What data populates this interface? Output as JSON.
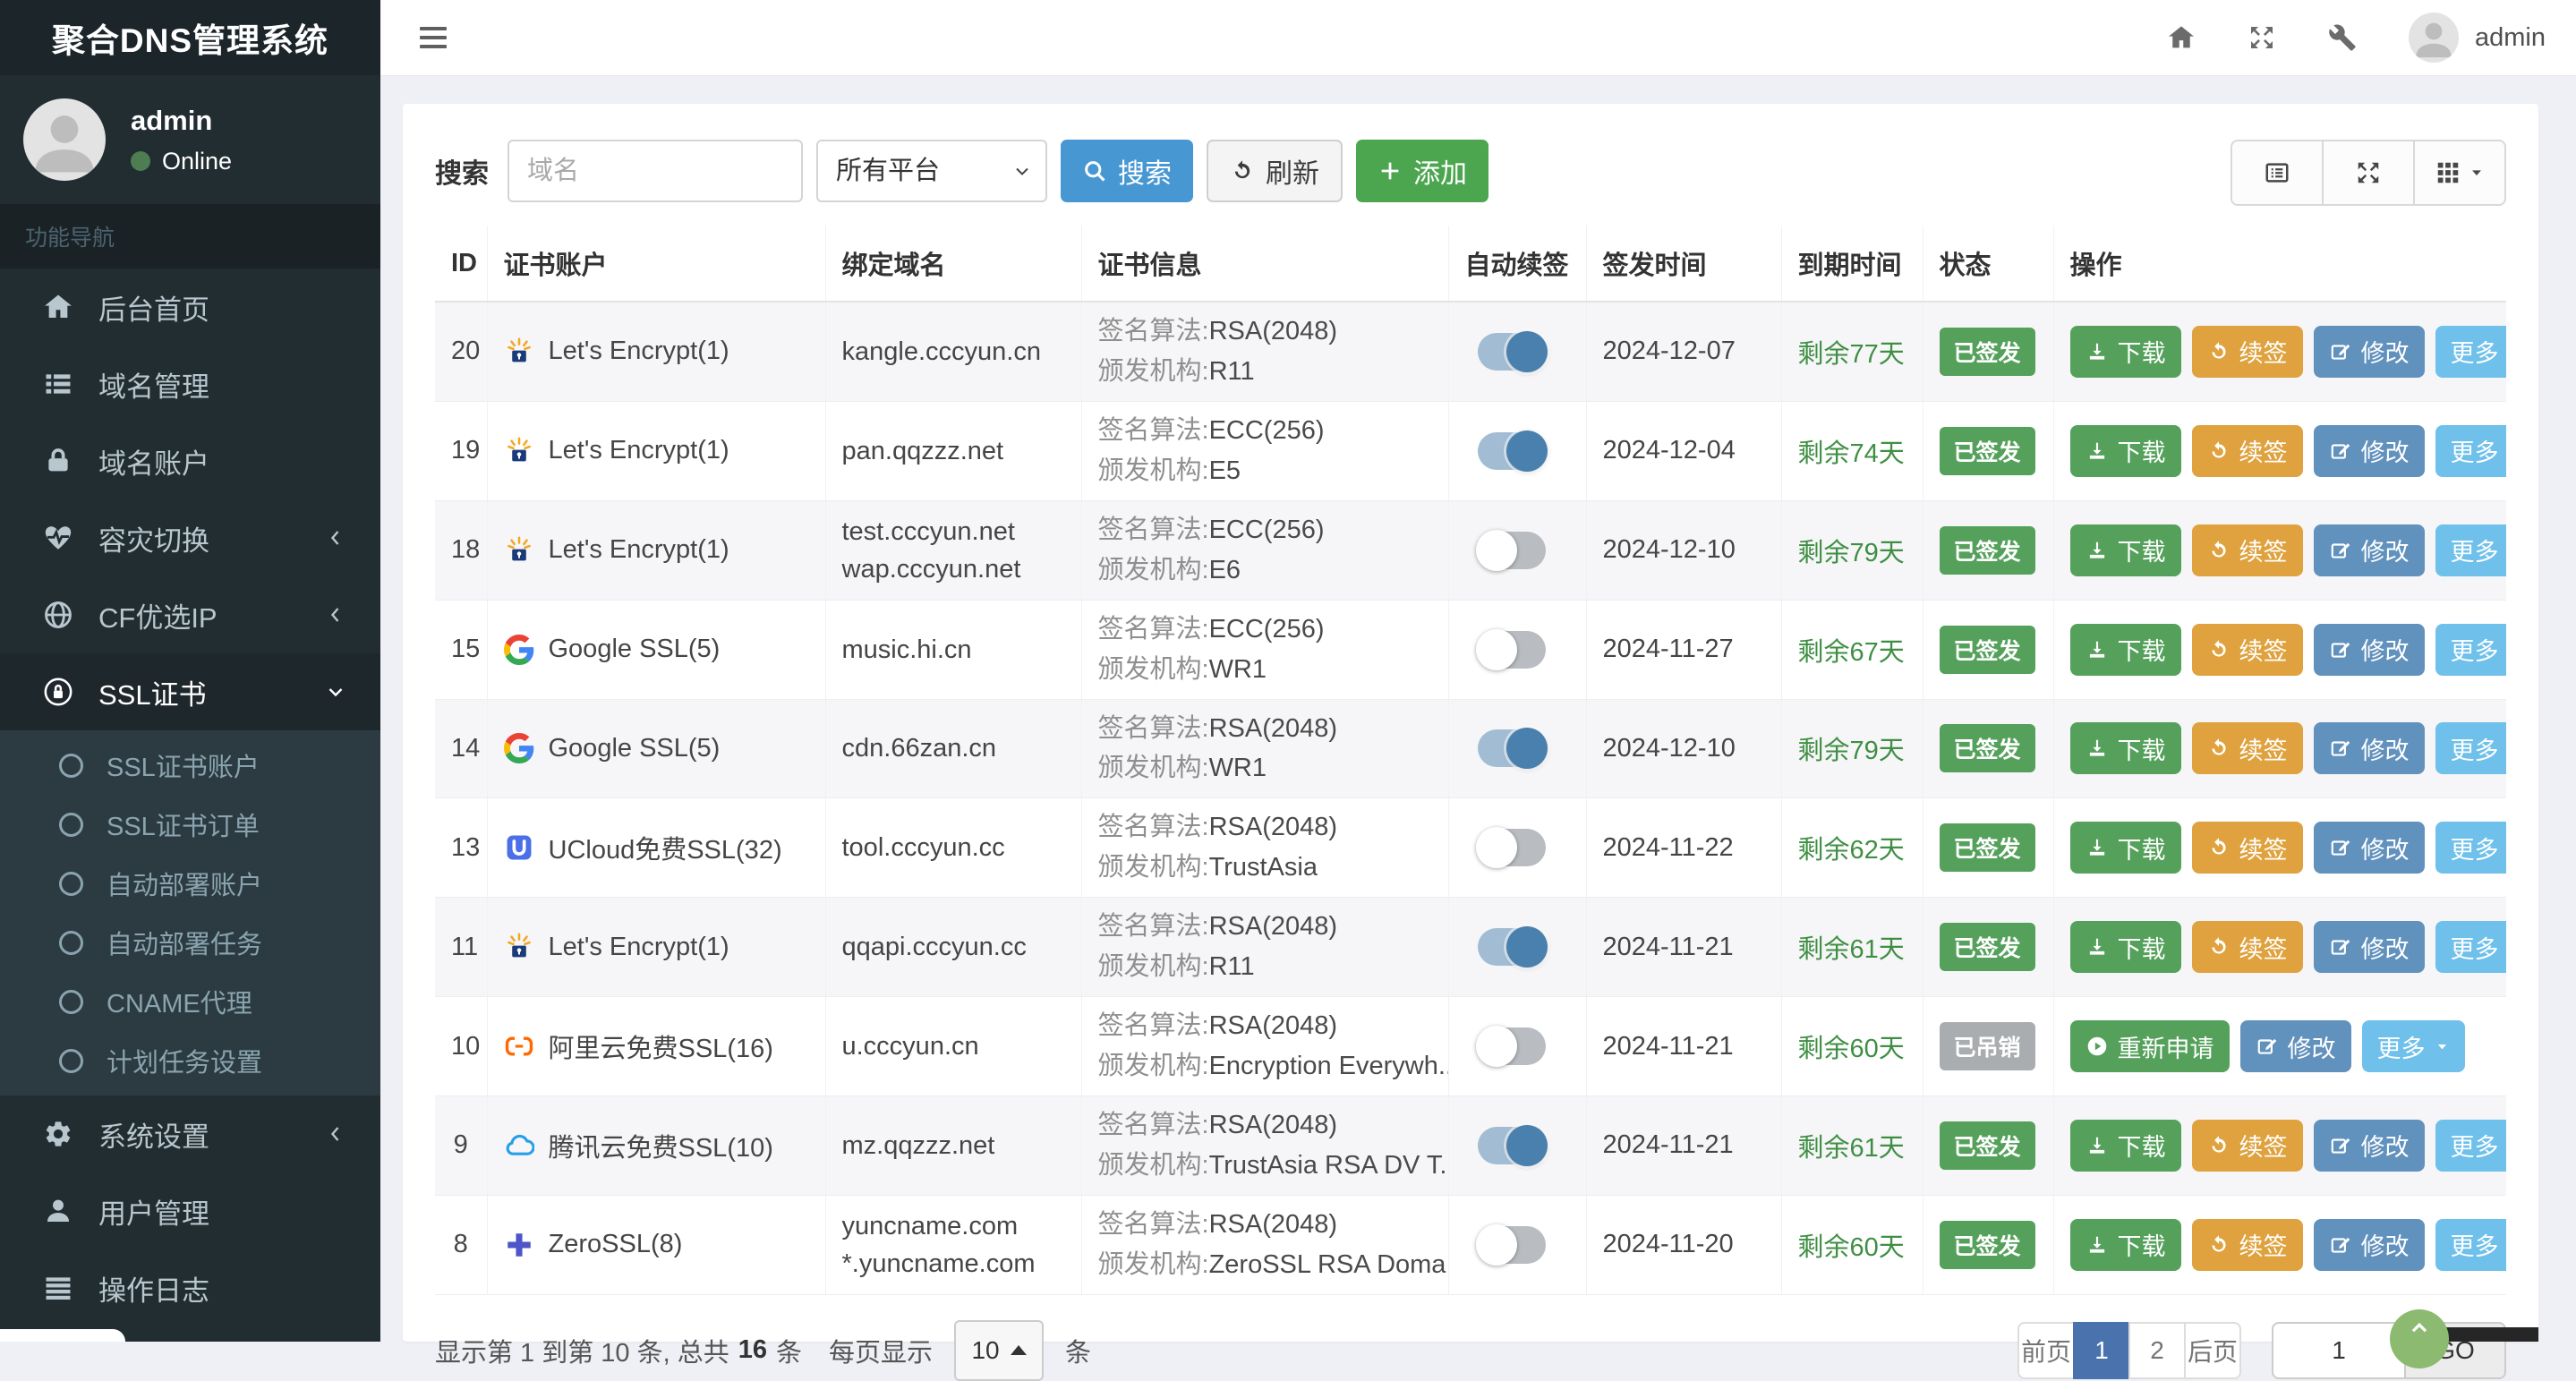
{
  "brand": {
    "title": "聚合DNS管理系统"
  },
  "user_panel": {
    "name": "admin",
    "status": "Online"
  },
  "sidebar": {
    "section_label": "功能导航",
    "items": [
      {
        "key": "home",
        "icon": "home-icon",
        "label": "后台首页"
      },
      {
        "key": "domain-manage",
        "icon": "list-icon",
        "label": "域名管理"
      },
      {
        "key": "domain-accounts",
        "icon": "lock-icon",
        "label": "域名账户"
      },
      {
        "key": "failover",
        "icon": "heartbeat-icon",
        "label": "容灾切换",
        "chevron": "left"
      },
      {
        "key": "cf-ip",
        "icon": "globe-icon",
        "label": "CF优选IP",
        "chevron": "left"
      },
      {
        "key": "ssl",
        "icon": "ssl-icon",
        "label": "SSL证书",
        "chevron": "down",
        "active": true,
        "children": [
          "SSL证书账户",
          "SSL证书订单",
          "自动部署账户",
          "自动部署任务",
          "CNAME代理",
          "计划任务设置"
        ]
      },
      {
        "key": "settings",
        "icon": "gears-icon",
        "label": "系统设置",
        "chevron": "left"
      },
      {
        "key": "users",
        "icon": "user-icon",
        "label": "用户管理"
      },
      {
        "key": "logs",
        "icon": "log-icon",
        "label": "操作日志"
      }
    ]
  },
  "topbar": {
    "user": "admin",
    "icons": [
      "home-icon",
      "arrows-expand-icon",
      "wrench-icon"
    ]
  },
  "toolbar": {
    "search_label": "搜索",
    "search_placeholder": "域名",
    "platform_select": "所有平台",
    "search_btn": "搜索",
    "refresh_btn": "刷新",
    "add_btn": "添加",
    "view_buttons": [
      {
        "icon": "list-alt-icon"
      },
      {
        "icon": "arrows-expand-icon"
      },
      {
        "icon": "grid-icon",
        "caret": true
      }
    ]
  },
  "table": {
    "columns": [
      "ID",
      "证书账户",
      "绑定域名",
      "证书信息",
      "自动续签",
      "签发时间",
      "到期时间",
      "状态",
      "操作"
    ],
    "info_labels": {
      "algo": "签名算法:",
      "issuer": "颁发机构:"
    },
    "rows": [
      {
        "id": "20",
        "provider_icon": "letsencrypt-icon",
        "account": "Let's Encrypt(1)",
        "domains": [
          "kangle.cccyun.cn"
        ],
        "algorithm": "RSA(2048)",
        "issuer": "R11",
        "auto_renew": true,
        "issued": "2024-12-07",
        "remaining": "剩余77天",
        "status": "已签发",
        "status_type": "success",
        "actions": [
          "download",
          "renew",
          "edit",
          "more"
        ]
      },
      {
        "id": "19",
        "provider_icon": "letsencrypt-icon",
        "account": "Let's Encrypt(1)",
        "domains": [
          "pan.qqzzz.net"
        ],
        "algorithm": "ECC(256)",
        "issuer": "E5",
        "auto_renew": true,
        "issued": "2024-12-04",
        "remaining": "剩余74天",
        "status": "已签发",
        "status_type": "success",
        "actions": [
          "download",
          "renew",
          "edit",
          "more"
        ]
      },
      {
        "id": "18",
        "provider_icon": "letsencrypt-icon",
        "account": "Let's Encrypt(1)",
        "domains": [
          "test.cccyun.net",
          "wap.cccyun.net"
        ],
        "algorithm": "ECC(256)",
        "issuer": "E6",
        "auto_renew": false,
        "issued": "2024-12-10",
        "remaining": "剩余79天",
        "status": "已签发",
        "status_type": "success",
        "actions": [
          "download",
          "renew",
          "edit",
          "more"
        ]
      },
      {
        "id": "15",
        "provider_icon": "google-icon",
        "account": "Google SSL(5)",
        "domains": [
          "music.hi.cn"
        ],
        "algorithm": "ECC(256)",
        "issuer": "WR1",
        "auto_renew": false,
        "issued": "2024-11-27",
        "remaining": "剩余67天",
        "status": "已签发",
        "status_type": "success",
        "actions": [
          "download",
          "renew",
          "edit",
          "more"
        ]
      },
      {
        "id": "14",
        "provider_icon": "google-icon",
        "account": "Google SSL(5)",
        "domains": [
          "cdn.66zan.cn"
        ],
        "algorithm": "RSA(2048)",
        "issuer": "WR1",
        "auto_renew": true,
        "issued": "2024-12-10",
        "remaining": "剩余79天",
        "status": "已签发",
        "status_type": "success",
        "actions": [
          "download",
          "renew",
          "edit",
          "more"
        ]
      },
      {
        "id": "13",
        "provider_icon": "ucloud-icon",
        "account": "UCloud免费SSL(32)",
        "domains": [
          "tool.cccyun.cc"
        ],
        "algorithm": "RSA(2048)",
        "issuer": "TrustAsia",
        "auto_renew": false,
        "issued": "2024-11-22",
        "remaining": "剩余62天",
        "status": "已签发",
        "status_type": "success",
        "actions": [
          "download",
          "renew",
          "edit",
          "more"
        ]
      },
      {
        "id": "11",
        "provider_icon": "letsencrypt-icon",
        "account": "Let's Encrypt(1)",
        "domains": [
          "qqapi.cccyun.cc"
        ],
        "algorithm": "RSA(2048)",
        "issuer": "R11",
        "auto_renew": true,
        "issued": "2024-11-21",
        "remaining": "剩余61天",
        "status": "已签发",
        "status_type": "success",
        "actions": [
          "download",
          "renew",
          "edit",
          "more"
        ]
      },
      {
        "id": "10",
        "provider_icon": "aliyun-icon",
        "account": "阿里云免费SSL(16)",
        "domains": [
          "u.cccyun.cn"
        ],
        "algorithm": "RSA(2048)",
        "issuer": "Encryption Everywh...",
        "auto_renew": false,
        "issued": "2024-11-21",
        "remaining": "剩余60天",
        "status": "已吊销",
        "status_type": "revoked",
        "actions": [
          "reapply",
          "edit",
          "more"
        ]
      },
      {
        "id": "9",
        "provider_icon": "tencentcloud-icon",
        "account": "腾讯云免费SSL(10)",
        "domains": [
          "mz.qqzzz.net"
        ],
        "algorithm": "RSA(2048)",
        "issuer": "TrustAsia RSA DV T...",
        "auto_renew": true,
        "issued": "2024-11-21",
        "remaining": "剩余61天",
        "status": "已签发",
        "status_type": "success",
        "actions": [
          "download",
          "renew",
          "edit",
          "more"
        ]
      },
      {
        "id": "8",
        "provider_icon": "zerossl-icon",
        "account": "ZeroSSL(8)",
        "domains": [
          "yuncname.com",
          "*.yuncname.com"
        ],
        "algorithm": "RSA(2048)",
        "issuer": "ZeroSSL RSA Doma...",
        "auto_renew": false,
        "issued": "2024-11-20",
        "remaining": "剩余60天",
        "status": "已签发",
        "status_type": "success",
        "actions": [
          "download",
          "renew",
          "edit",
          "more"
        ]
      }
    ]
  },
  "actions": {
    "download": {
      "label": "下载",
      "icon": "download-icon",
      "style": "green"
    },
    "renew": {
      "label": "续签",
      "icon": "renew-icon",
      "style": "orange"
    },
    "edit": {
      "label": "修改",
      "icon": "edit-icon",
      "style": "steel"
    },
    "more": {
      "label": "更多",
      "style": "sky",
      "caret": true
    },
    "reapply": {
      "label": "重新申请",
      "icon": "play-icon",
      "style": "green"
    }
  },
  "pagination": {
    "summary_prefix": "显示第 1 到第 10 条, 总共",
    "total": "16",
    "summary_suffix": "条",
    "per_page_label": "每页显示",
    "page_size": "10",
    "unit": "条",
    "pages": [
      {
        "label": "前页",
        "type": "disabled"
      },
      {
        "label": "1",
        "type": "active"
      },
      {
        "label": "2",
        "type": "page"
      },
      {
        "label": "后页",
        "type": "page"
      }
    ],
    "goto_value": "1",
    "go_btn": "GO"
  },
  "palette": {
    "sidebar_bg": "#222d32",
    "sidebar_brand_bg": "#1b252a",
    "sidebar_active_bg": "#1e272c",
    "submenu_bg": "#2c3b41",
    "content_bg": "#eef0f5",
    "primary_blue": "#4797d3",
    "success_green": "#55a15c",
    "add_green": "#4ca54f",
    "warning_orange": "#dfa23e",
    "steel_blue": "#6191bd",
    "sky_blue": "#6fc0ea",
    "active_page_blue": "#4a72ad",
    "remaining_green": "#3f8f43",
    "revoked_gray": "#aaadb0",
    "toggle_on": "#4a80ad",
    "online_dot": "#4e7d52"
  }
}
